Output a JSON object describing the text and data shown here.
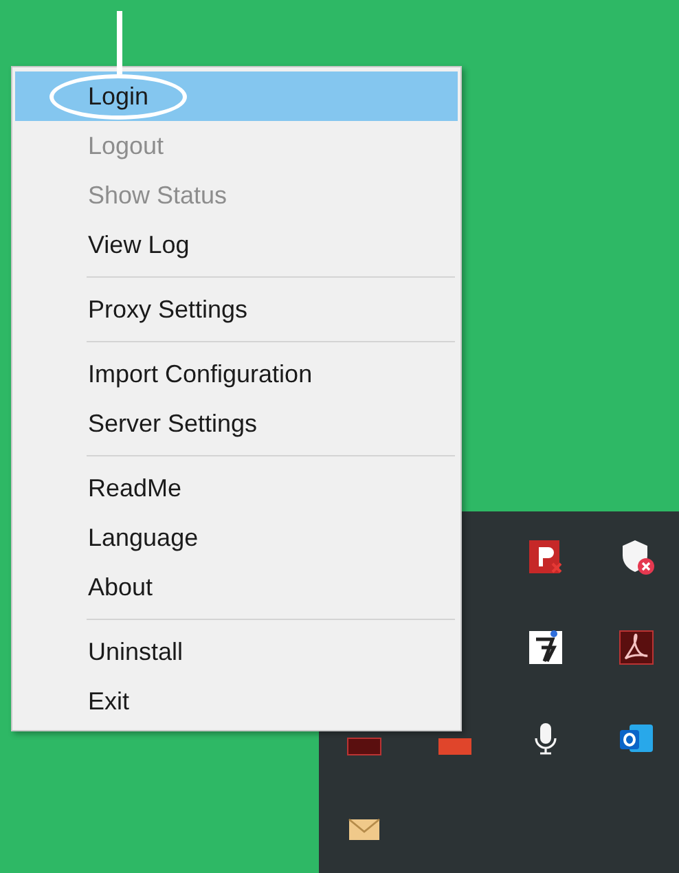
{
  "menu": {
    "groups": [
      {
        "items": [
          {
            "label": "Login",
            "selected": true,
            "disabled": false,
            "annotated": true
          },
          {
            "label": "Logout",
            "selected": false,
            "disabled": true,
            "annotated": false
          },
          {
            "label": "Show Status",
            "selected": false,
            "disabled": true,
            "annotated": false
          },
          {
            "label": "View Log",
            "selected": false,
            "disabled": false,
            "annotated": false
          }
        ]
      },
      {
        "items": [
          {
            "label": "Proxy Settings",
            "selected": false,
            "disabled": false,
            "annotated": false
          }
        ]
      },
      {
        "items": [
          {
            "label": "Import Configuration",
            "selected": false,
            "disabled": false,
            "annotated": false
          },
          {
            "label": "Server Settings",
            "selected": false,
            "disabled": false,
            "annotated": false
          }
        ]
      },
      {
        "items": [
          {
            "label": "ReadMe",
            "selected": false,
            "disabled": false,
            "annotated": false
          },
          {
            "label": "Language",
            "selected": false,
            "disabled": false,
            "annotated": false
          },
          {
            "label": "About",
            "selected": false,
            "disabled": false,
            "annotated": false
          }
        ]
      },
      {
        "items": [
          {
            "label": "Uninstall",
            "selected": false,
            "disabled": false,
            "annotated": false
          },
          {
            "label": "Exit",
            "selected": false,
            "disabled": false,
            "annotated": false
          }
        ]
      }
    ]
  }
}
